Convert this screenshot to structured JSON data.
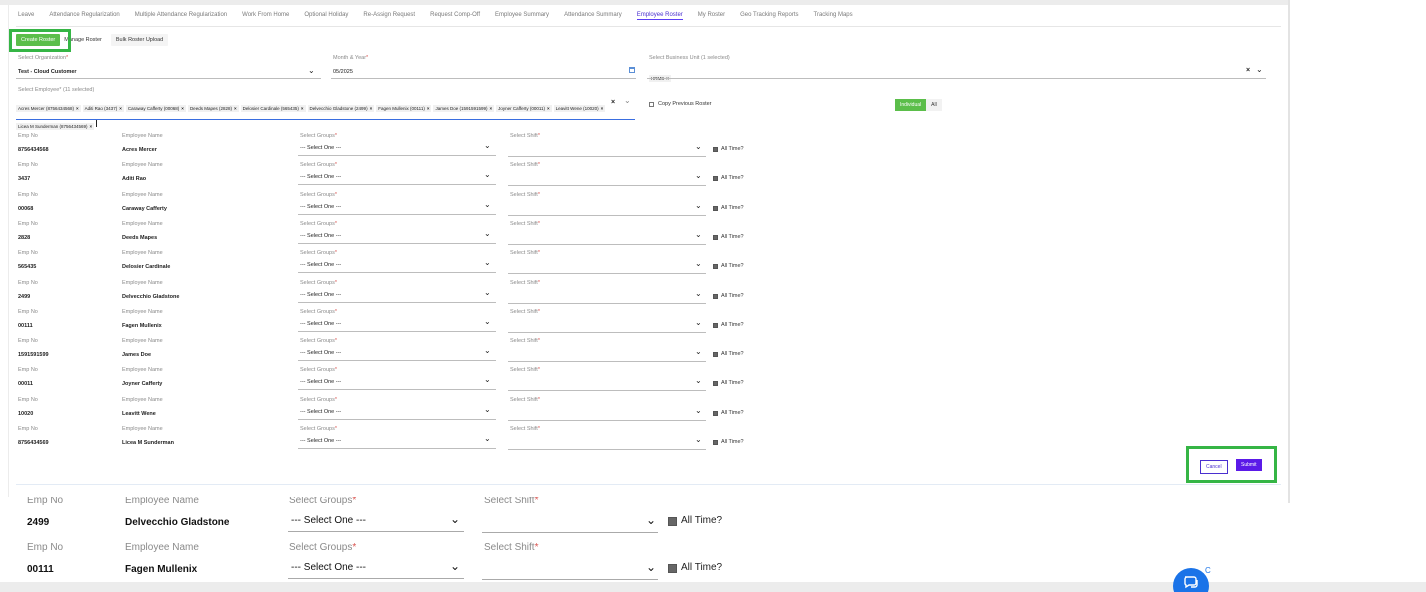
{
  "tabs": [
    {
      "label": "Leave"
    },
    {
      "label": "Attendance Regularization"
    },
    {
      "label": "Multiple Attendance Regularization"
    },
    {
      "label": "Work From Home"
    },
    {
      "label": "Optional Holiday"
    },
    {
      "label": "Re-Assign Request"
    },
    {
      "label": "Request Comp-Off"
    },
    {
      "label": "Employee Summary"
    },
    {
      "label": "Attendance Summary"
    },
    {
      "label": "Employee Roster"
    },
    {
      "label": "My Roster"
    },
    {
      "label": "Geo Tracking Reports"
    },
    {
      "label": "Tracking Maps"
    }
  ],
  "active_tab": "Employee Roster",
  "subtabs": {
    "create": "Create Roster",
    "manage": "Manage Roster",
    "bulk": "Bulk Roster Upload"
  },
  "form": {
    "org_label": "Select Organization",
    "org_value": "Test - Cloud Customer",
    "month_label": "Month & Year",
    "month_value": "05/2025",
    "bu_label": "Select Business Unit (1 selected)",
    "bu_chip": "HRMS",
    "emp_label": "Select Employee* (11 selected)",
    "emp_chips": [
      "Acres Mercer (8756434568)",
      "Aditi Rao (3437)",
      "Caraway Cafferty (00068)",
      "Deeds Mapes (2828)",
      "Delosier Cardinale (565435)",
      "Delvecchio Gladstone (2499)",
      "Fagen Mullenix (00111)",
      "James Doe (1591591599)",
      "Joyner Cafferty (00011)",
      "Leavitt Wene (10020)",
      "Licea M Sunderman (8756434569)"
    ],
    "copy_roster": "Copy Previous Roster",
    "toggle_individual": "Individual",
    "toggle_all": "All",
    "required_mark": "*",
    "chip_x": "×"
  },
  "table": {
    "emp_no_label": "Emp No",
    "emp_name_label": "Employee Name",
    "groups_label": "Select Groups",
    "shift_label": "Select Shift",
    "select_one": "--- Select One ---",
    "all_time": "All Time?",
    "rows": [
      {
        "emp_no": "8756434568",
        "name": "Acres Mercer"
      },
      {
        "emp_no": "3437",
        "name": "Aditi Rao"
      },
      {
        "emp_no": "00068",
        "name": "Caraway Cafferty"
      },
      {
        "emp_no": "2828",
        "name": "Deeds Mapes"
      },
      {
        "emp_no": "565435",
        "name": "Delosier Cardinale"
      },
      {
        "emp_no": "2499",
        "name": "Delvecchio Gladstone"
      },
      {
        "emp_no": "00111",
        "name": "Fagen Mullenix"
      },
      {
        "emp_no": "1591591599",
        "name": "James Doe"
      },
      {
        "emp_no": "00011",
        "name": "Joyner Cafferty"
      },
      {
        "emp_no": "10020",
        "name": "Leavitt Wene"
      },
      {
        "emp_no": "8756434569",
        "name": "Licea M Sunderman"
      }
    ]
  },
  "actions": {
    "cancel": "Cancel",
    "submit": "Submit"
  },
  "zoom": {
    "emp_no_label": "Emp No",
    "emp_name_label": "Employee Name",
    "groups_label": "Select Groups",
    "shift_label": "Select Shift",
    "select_one": "--- Select One ---",
    "all_time": "All Time?",
    "rows": [
      {
        "emp_no": "2499",
        "name": "Delvecchio Gladstone"
      },
      {
        "emp_no": "00111",
        "name": "Fagen Mullenix"
      }
    ]
  },
  "colors": {
    "accent_green": "#5bbe4a",
    "highlight_green": "#35b545",
    "primary_purple": "#5b1ae8"
  }
}
